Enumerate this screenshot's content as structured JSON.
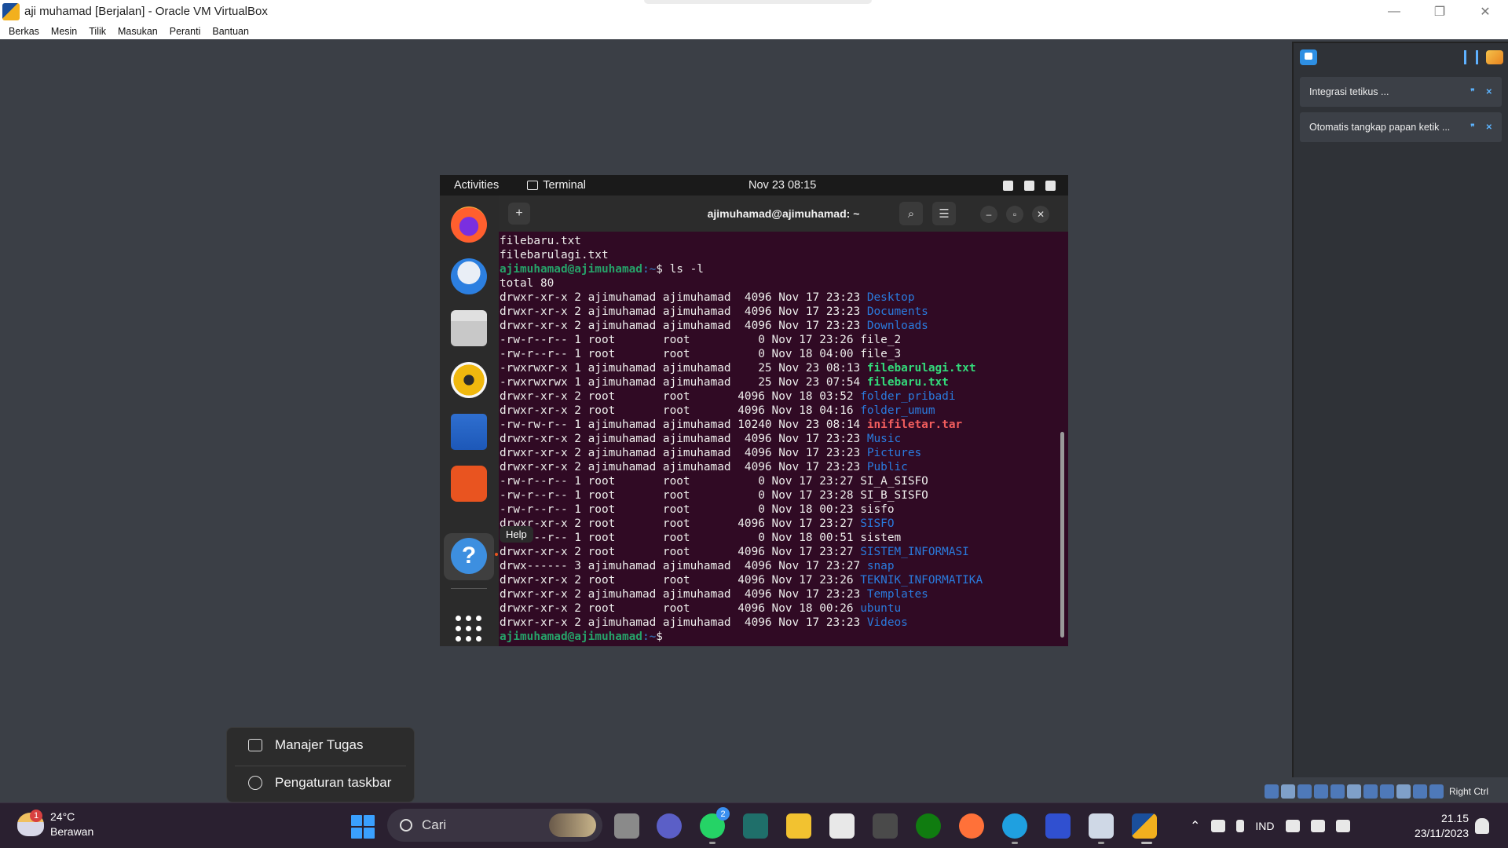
{
  "window": {
    "title": "aji muhamad  [Berjalan] - Oracle VM VirtualBox"
  },
  "vb_menu": [
    "Berkas",
    "Mesin",
    "Tilik",
    "Masukan",
    "Peranti",
    "Bantuan"
  ],
  "notifications": [
    {
      "text": "Integrasi tetikus ..."
    },
    {
      "text": "Otomatis tangkap papan ketik ..."
    }
  ],
  "vb_status": {
    "host_key": "Right Ctrl"
  },
  "ubuntu": {
    "activities": "Activities",
    "app_name": "Terminal",
    "clock": "Nov 23  08:15",
    "tooltip": "Help"
  },
  "terminal": {
    "title": "ajimuhamad@ajimuhamad: ~",
    "lines": [
      {
        "type": "plain",
        "text": "filebaru.txt"
      },
      {
        "type": "plain",
        "text": "filebarulagi.txt"
      },
      {
        "type": "prompt",
        "user": "ajimuhamad@ajimuhamad",
        "path": ":~",
        "cmd": "$ ls -l"
      },
      {
        "type": "plain",
        "text": "total 80"
      },
      {
        "type": "ls",
        "meta": "drwxr-xr-x 2 ajimuhamad ajimuhamad  4096 Nov 17 23:23 ",
        "name": "Desktop",
        "kind": "dir"
      },
      {
        "type": "ls",
        "meta": "drwxr-xr-x 2 ajimuhamad ajimuhamad  4096 Nov 17 23:23 ",
        "name": "Documents",
        "kind": "dir"
      },
      {
        "type": "ls",
        "meta": "drwxr-xr-x 2 ajimuhamad ajimuhamad  4096 Nov 17 23:23 ",
        "name": "Downloads",
        "kind": "dir"
      },
      {
        "type": "ls",
        "meta": "-rw-r--r-- 1 root       root          0 Nov 17 23:26 ",
        "name": "file_2",
        "kind": "file"
      },
      {
        "type": "ls",
        "meta": "-rw-r--r-- 1 root       root          0 Nov 18 04:00 ",
        "name": "file_3",
        "kind": "file"
      },
      {
        "type": "ls",
        "meta": "-rwxrwxr-x 1 ajimuhamad ajimuhamad    25 Nov 23 08:13 ",
        "name": "filebarulagi.txt",
        "kind": "exec"
      },
      {
        "type": "ls",
        "meta": "-rwxrwxrwx 1 ajimuhamad ajimuhamad    25 Nov 23 07:54 ",
        "name": "filebaru.txt",
        "kind": "exec"
      },
      {
        "type": "ls",
        "meta": "drwxr-xr-x 2 root       root       4096 Nov 18 03:52 ",
        "name": "folder_pribadi",
        "kind": "dir"
      },
      {
        "type": "ls",
        "meta": "drwxr-xr-x 2 root       root       4096 Nov 18 04:16 ",
        "name": "folder_umum",
        "kind": "dir"
      },
      {
        "type": "ls",
        "meta": "-rw-rw-r-- 1 ajimuhamad ajimuhamad 10240 Nov 23 08:14 ",
        "name": "inifiletar.tar",
        "kind": "arch"
      },
      {
        "type": "ls",
        "meta": "drwxr-xr-x 2 ajimuhamad ajimuhamad  4096 Nov 17 23:23 ",
        "name": "Music",
        "kind": "dir"
      },
      {
        "type": "ls",
        "meta": "drwxr-xr-x 2 ajimuhamad ajimuhamad  4096 Nov 17 23:23 ",
        "name": "Pictures",
        "kind": "dir"
      },
      {
        "type": "ls",
        "meta": "drwxr-xr-x 2 ajimuhamad ajimuhamad  4096 Nov 17 23:23 ",
        "name": "Public",
        "kind": "dir"
      },
      {
        "type": "ls",
        "meta": "-rw-r--r-- 1 root       root          0 Nov 17 23:27 ",
        "name": "SI_A_SISFO",
        "kind": "file"
      },
      {
        "type": "ls",
        "meta": "-rw-r--r-- 1 root       root          0 Nov 17 23:28 ",
        "name": "SI_B_SISFO",
        "kind": "file"
      },
      {
        "type": "ls",
        "meta": "-rw-r--r-- 1 root       root          0 Nov 18 00:23 ",
        "name": "sisfo",
        "kind": "file"
      },
      {
        "type": "ls",
        "meta": "drwxr-xr-x 2 root       root       4096 Nov 17 23:27 ",
        "name": "SISFO",
        "kind": "dir"
      },
      {
        "type": "ls",
        "meta": "-rw-r--r-- 1 root       root          0 Nov 18 00:51 ",
        "name": "sistem",
        "kind": "file"
      },
      {
        "type": "ls",
        "meta": "drwxr-xr-x 2 root       root       4096 Nov 17 23:27 ",
        "name": "SISTEM_INFORMASI",
        "kind": "dir"
      },
      {
        "type": "ls",
        "meta": "drwx------ 3 ajimuhamad ajimuhamad  4096 Nov 17 23:27 ",
        "name": "snap",
        "kind": "dir"
      },
      {
        "type": "ls",
        "meta": "drwxr-xr-x 2 root       root       4096 Nov 17 23:26 ",
        "name": "TEKNIK_INFORMATIKA",
        "kind": "dir"
      },
      {
        "type": "ls",
        "meta": "drwxr-xr-x 2 ajimuhamad ajimuhamad  4096 Nov 17 23:23 ",
        "name": "Templates",
        "kind": "dir"
      },
      {
        "type": "ls",
        "meta": "drwxr-xr-x 2 root       root       4096 Nov 18 00:26 ",
        "name": "ubuntu",
        "kind": "dir"
      },
      {
        "type": "ls",
        "meta": "drwxr-xr-x 2 ajimuhamad ajimuhamad  4096 Nov 17 23:23 ",
        "name": "Videos",
        "kind": "dir"
      },
      {
        "type": "prompt",
        "user": "ajimuhamad@ajimuhamad",
        "path": ":~",
        "cmd": "$ "
      }
    ]
  },
  "context_menu": {
    "task_manager": "Manajer Tugas",
    "taskbar_settings": "Pengaturan taskbar"
  },
  "taskbar": {
    "weather_temp": "24°C",
    "weather_desc": "Berawan",
    "weather_badge": "1",
    "search_placeholder": "Cari",
    "whatsapp_badge": "2",
    "language": "IND",
    "time": "21.15",
    "date": "23/11/2023"
  },
  "colors": {
    "terminal_bg": "#300a24",
    "dir": "#2a7bde",
    "exec": "#33da7a",
    "archive": "#f15d5d",
    "prompt_user": "#26a269"
  }
}
